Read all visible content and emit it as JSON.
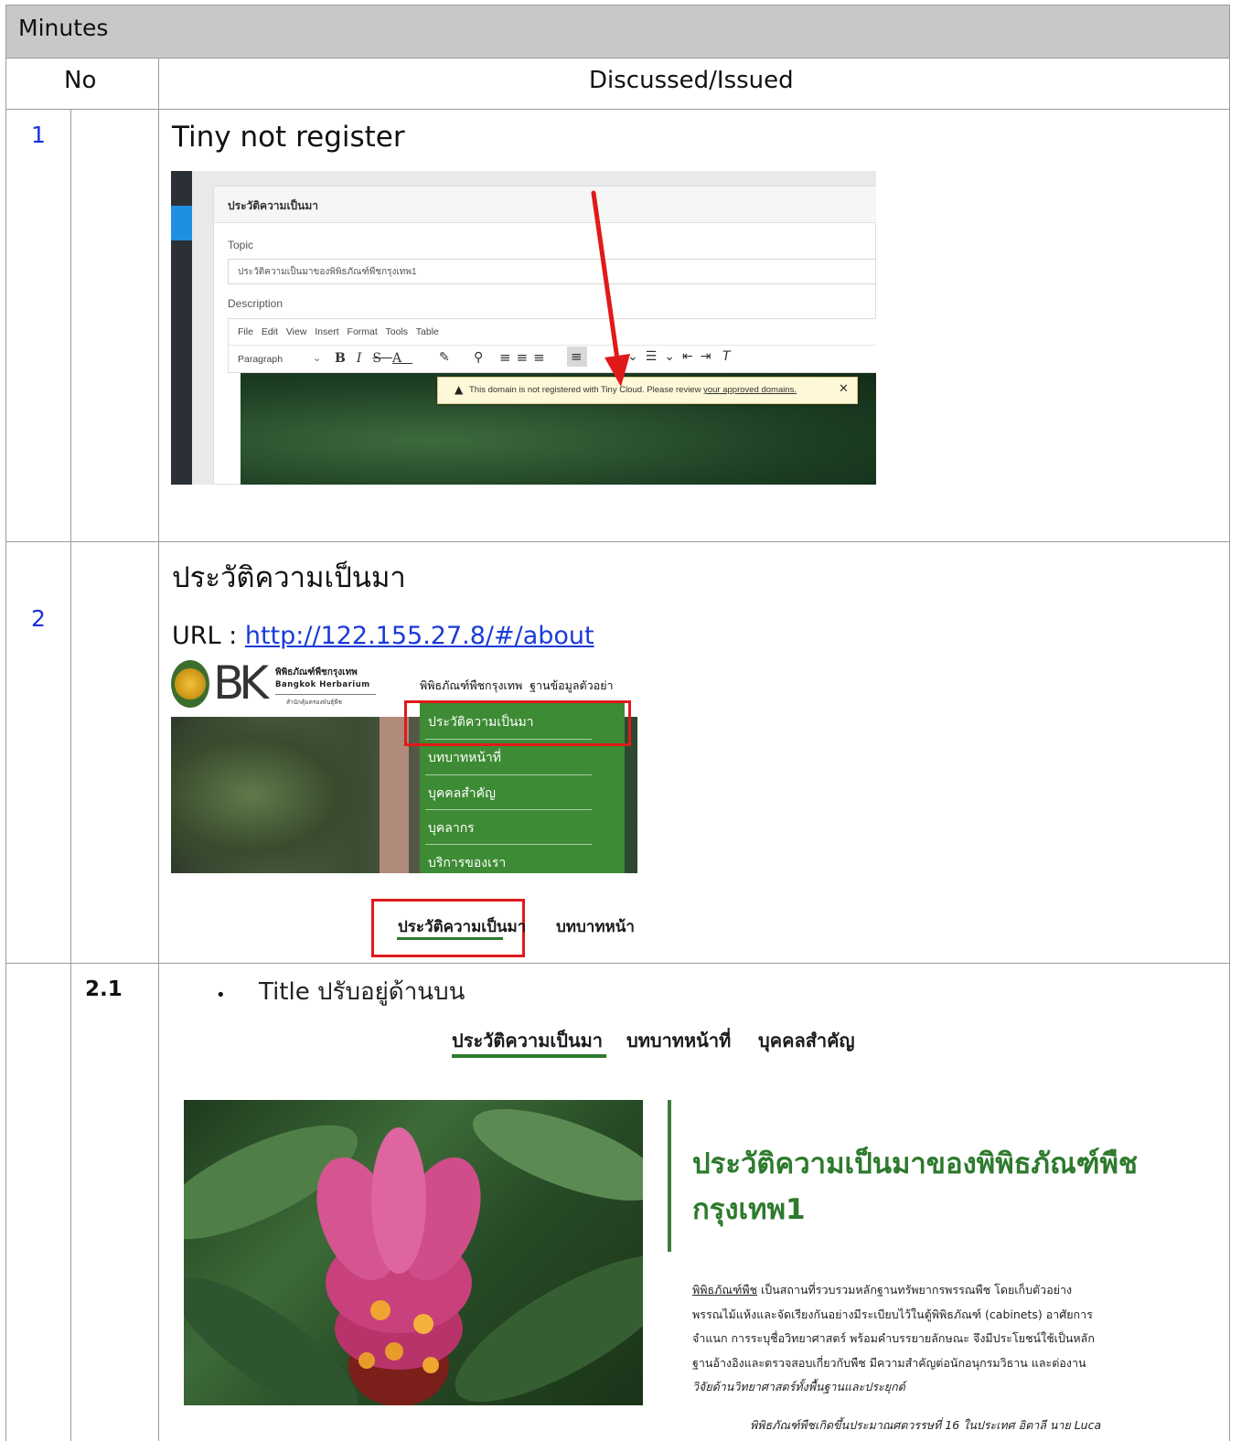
{
  "header": {
    "title": "Minutes"
  },
  "columns": {
    "no": "No",
    "discussed": "Discussed/Issued"
  },
  "rows": [
    {
      "number": "1",
      "title": "Tiny not register",
      "screenshot": {
        "panel_title": "ประวัติความเป็นมา",
        "topic_label": "Topic",
        "topic_value": "ประวัติความเป็นมาของพิพิธภัณฑ์พืชกรุงเทพ1",
        "description_label": "Description",
        "menu": [
          "File",
          "Edit",
          "View",
          "Insert",
          "Format",
          "Tools",
          "Table"
        ],
        "paragraph_label": "Paragraph",
        "warning_text": "This domain is not registered with Tiny Cloud. Please review",
        "warning_link": "your approved domains."
      }
    },
    {
      "number": "2",
      "title": "ประวัติความเป็นมา",
      "url_label": "URL : ",
      "url": "http://122.155.27.8/#/about",
      "screenshot": {
        "site_name_th": "พิพิธภัณฑ์พืชกรุงเทพ",
        "site_name_en": "Bangkok Herbarium",
        "site_sub": "สำนักคุ้มครองพันธุ์พืช",
        "nav": [
          "พิพิธภัณฑ์พืชกรุงเทพ",
          "ฐานข้อมูลตัวอย่า"
        ],
        "dropdown": [
          "ประวัติความเป็นมา",
          "บทบาทหน้าที่",
          "บุคคลสำคัญ",
          "บุคลากร",
          "บริการของเรา"
        ],
        "tabs": [
          "ประวัติความเป็นมา",
          "บทบาทหน้า"
        ]
      }
    }
  ],
  "sub_row": {
    "number": "2.1",
    "bullet": "Title ปรับอยู่ด้านบน",
    "tabs": [
      "ประวัติความเป็นมา",
      "บทบาทหน้าที่",
      "บุคคลสำคัญ"
    ],
    "heading": "ประวัติความเป็นมาของพิพิธภัณฑ์พืช กรุงเทพ1",
    "para_link": "พิพิธภัณฑ์พืช",
    "para_lines": [
      " เป็นสถานที่รวบรวมหลักฐานทรัพยากรพรรณพืช โดยเก็บตัวอย่าง",
      "พรรณไม้แห้งและจัดเรียงกันอย่างมีระเบียบไว้ในตู้พิพิธภัณฑ์ (cabinets) อาศัยการ",
      "จำแนก การระบุชื่อวิทยาศาสตร์ พร้อมคำบรรยายลักษณะ จึงมีประโยชน์ใช้เป็นหลัก",
      "ฐานอ้างอิงและตรวจสอบเกี่ยวกับพืช มีความสำคัญต่อนักอนุกรมวิธาน และต่องาน",
      "วิจัยด้านวิทยาศาสตร์ทั้งพื้นฐานและประยุกต์"
    ],
    "italic_line": "พิพิธภัณฑ์พืชเกิดขึ้นประมาณศตวรรษที่ 16 ในประเทศ อิตาลี นาย Luca"
  }
}
